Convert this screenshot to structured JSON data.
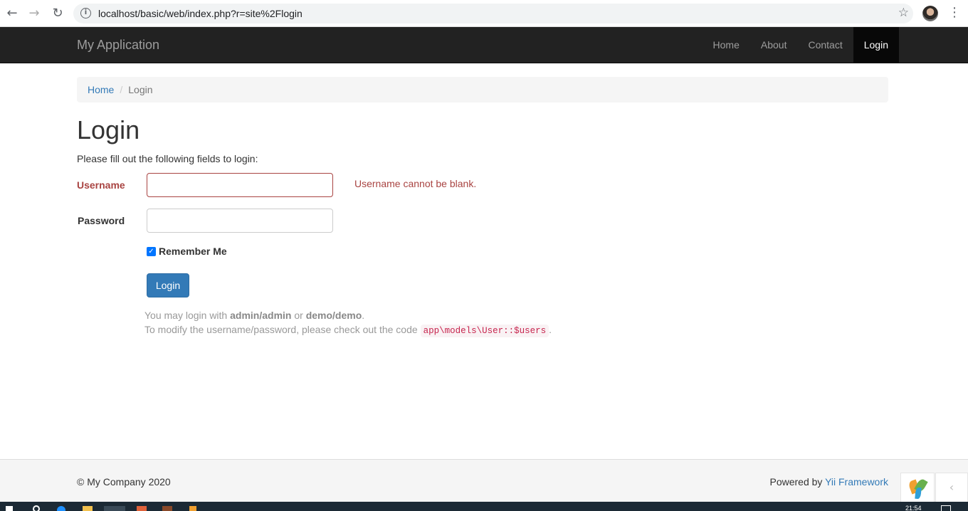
{
  "browser": {
    "url": "localhost/basic/web/index.php?r=site%2Flogin",
    "back_icon": "←",
    "forward_icon": "→",
    "reload_icon": "↻",
    "info_icon": "i",
    "star_icon": "☆",
    "menu_icon": "⋮"
  },
  "navbar": {
    "brand": "My Application",
    "items": [
      {
        "label": "Home",
        "active": false
      },
      {
        "label": "About",
        "active": false
      },
      {
        "label": "Contact",
        "active": false
      },
      {
        "label": "Login",
        "active": true
      }
    ]
  },
  "breadcrumb": {
    "home": "Home",
    "separator": "/",
    "current": "Login"
  },
  "page": {
    "title": "Login",
    "intro": "Please fill out the following fields to login:"
  },
  "form": {
    "username_label": "Username",
    "username_value": "",
    "username_error": "Username cannot be blank.",
    "password_label": "Password",
    "password_value": "",
    "remember_label": "Remember Me",
    "remember_checked": true,
    "checkmark": "✓",
    "submit_label": "Login"
  },
  "hint": {
    "line1_prefix": "You may login with ",
    "cred1": "admin/admin",
    "line1_or": " or ",
    "cred2": "demo/demo",
    "line1_suffix": ".",
    "line2_prefix": "To modify the username/password, please check out the code ",
    "code": "app\\models\\User::$users",
    "line2_suffix": "."
  },
  "footer": {
    "copyright": "© My Company 2020",
    "powered_prefix": "Powered by ",
    "powered_link": "Yii Framework",
    "toggle_icon": "‹"
  },
  "taskbar": {
    "clock": "21:54"
  },
  "colors": {
    "navbar_bg": "#222222",
    "link": "#337ab7",
    "error": "#a94442",
    "button": "#337ab7"
  }
}
